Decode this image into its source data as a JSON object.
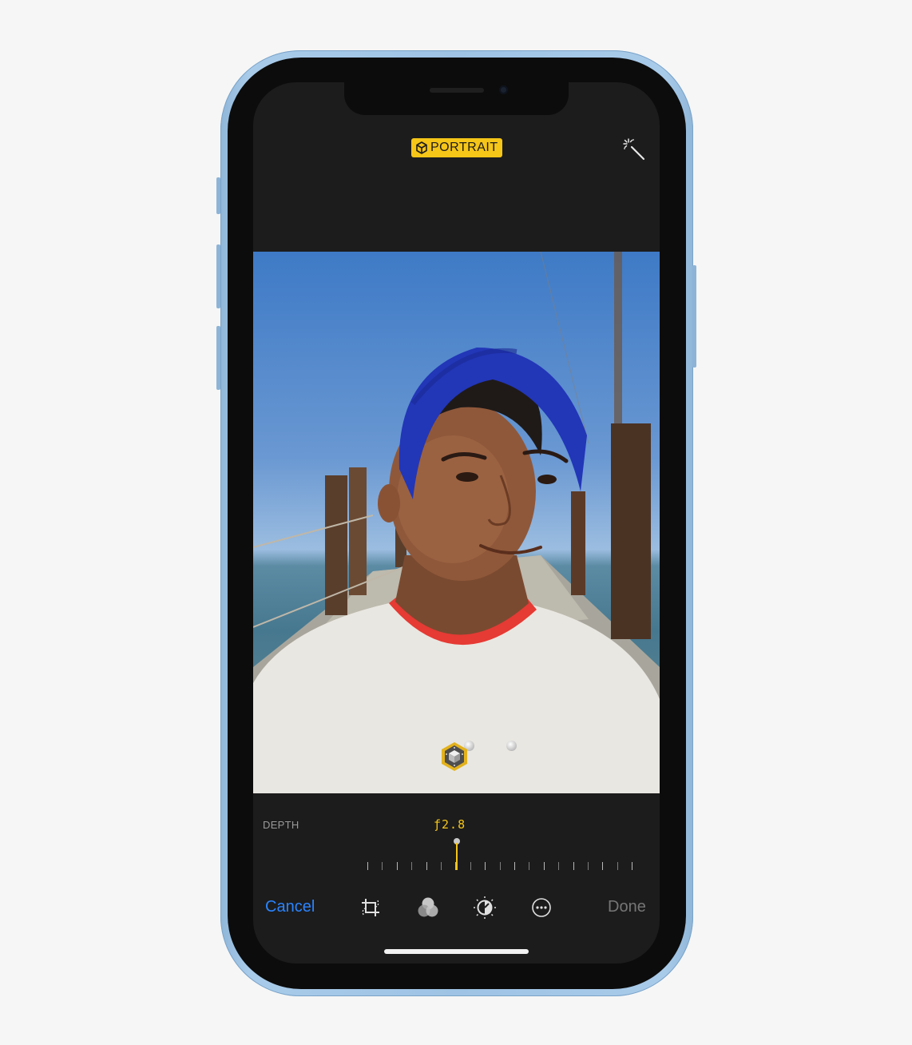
{
  "device": {
    "frame_color": "#9ec3e4",
    "accent_color": "#f5c518",
    "link_color": "#2a84ff"
  },
  "header": {
    "mode_badge_label": "PORTRAIT",
    "mode_badge_icon": "cube-icon",
    "auto_enhance_icon": "magic-wand-icon"
  },
  "photo": {
    "lighting_effects": [
      {
        "icon": "lighting-cube-icon",
        "selected": true
      },
      {
        "icon": "dot-icon",
        "selected": false
      },
      {
        "icon": "dot-icon",
        "selected": false
      }
    ]
  },
  "depth": {
    "label": "DEPTH",
    "value": "ƒ2.8"
  },
  "toolbar": {
    "cancel_label": "Cancel",
    "done_label": "Done",
    "tools": [
      "crop-rotate-icon",
      "filters-icon",
      "adjust-dial-icon",
      "more-icon"
    ]
  }
}
